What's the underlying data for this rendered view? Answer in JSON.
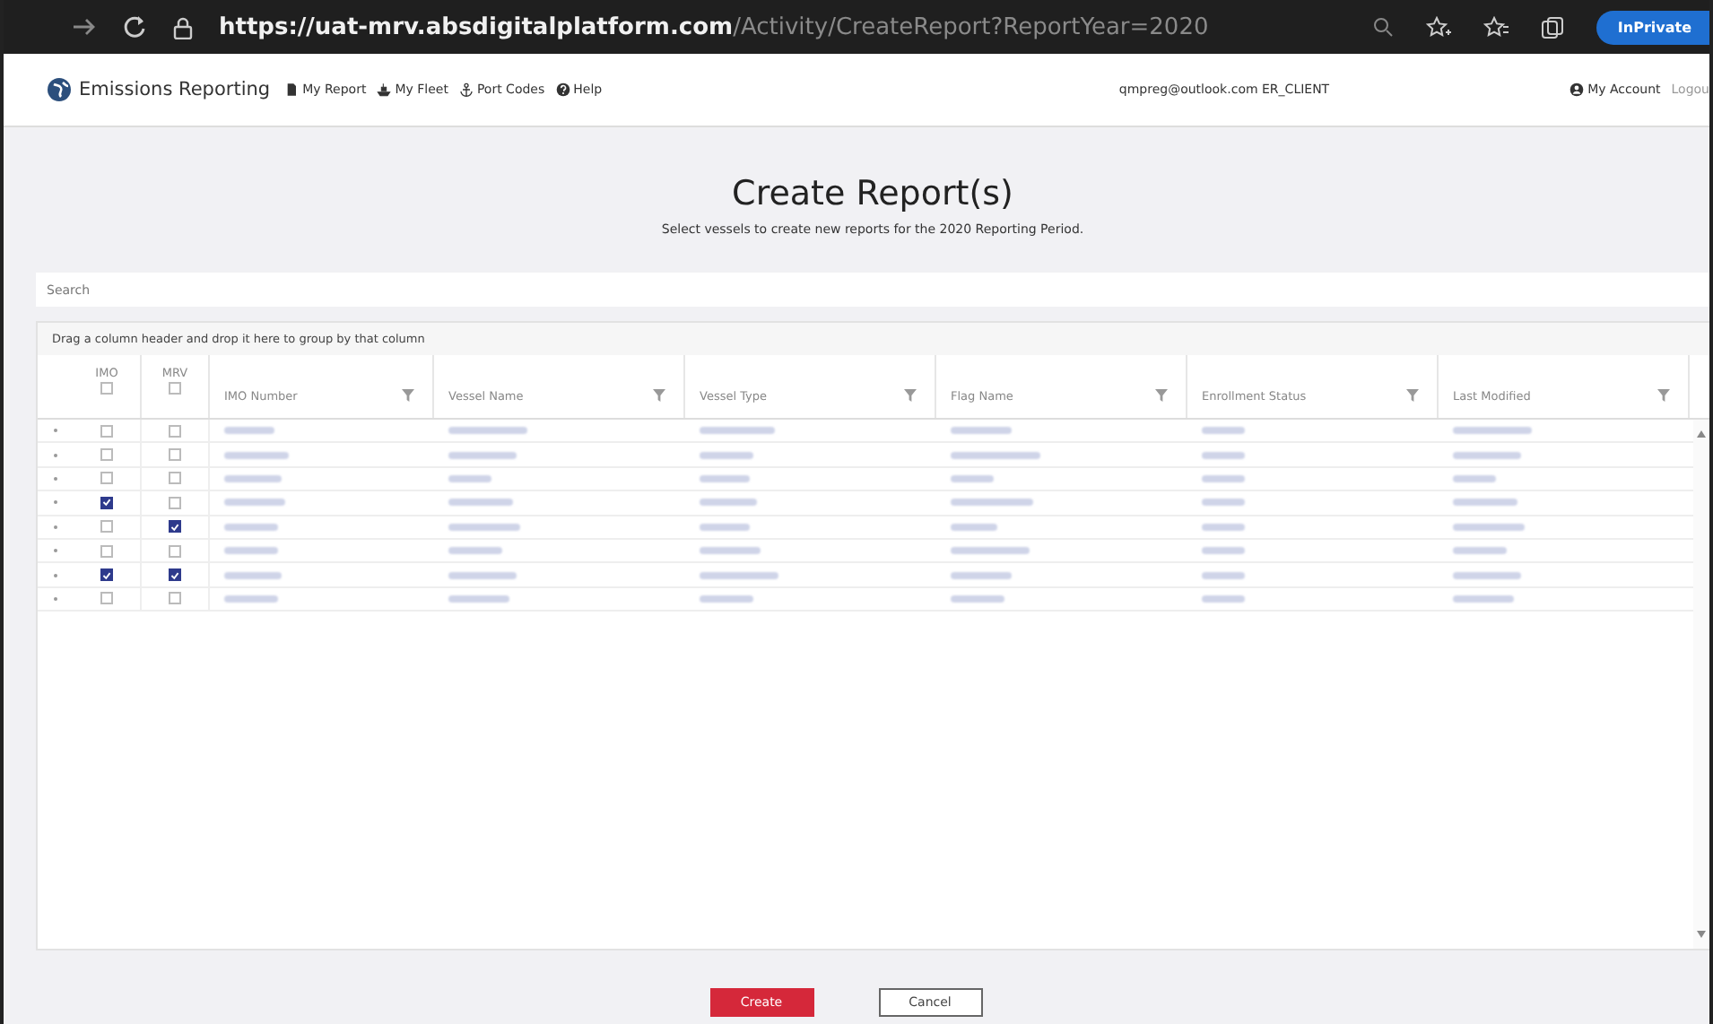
{
  "browser": {
    "url_host": "https://uat-mrv.absdigitalplatform.com",
    "url_path": "/Activity/CreateReport?ReportYear=2020",
    "badge": "InPrivate"
  },
  "nav": {
    "brand": "Emissions Reporting",
    "links": [
      {
        "kind": "report",
        "label": "My Report"
      },
      {
        "kind": "fleet",
        "label": "My Fleet"
      },
      {
        "kind": "anchor",
        "label": "Port Codes"
      },
      {
        "kind": "help",
        "label": "Help"
      }
    ],
    "user": "qmpreg@outlook.com ER_CLIENT",
    "account": "My Account",
    "logout": "Logou"
  },
  "page": {
    "title": "Create Report(s)",
    "subtitle": "Select vessels to create new reports for the 2020 Reporting Period."
  },
  "search": {
    "placeholder": "Search"
  },
  "grid": {
    "group_hint": "Drag a column header and drop it here to group by that column",
    "check_columns": [
      {
        "label": "IMO",
        "checked": false
      },
      {
        "label": "MRV",
        "checked": false
      }
    ],
    "columns": [
      "IMO Number",
      "Vessel Name",
      "Vessel Type",
      "Flag Name",
      "Enrollment Status",
      "Last Modified"
    ],
    "rows": [
      {
        "imo": false,
        "mrv": false
      },
      {
        "imo": false,
        "mrv": false
      },
      {
        "imo": false,
        "mrv": false
      },
      {
        "imo": true,
        "mrv": false
      },
      {
        "imo": false,
        "mrv": true
      },
      {
        "imo": false,
        "mrv": false
      },
      {
        "imo": true,
        "mrv": true
      },
      {
        "imo": false,
        "mrv": false
      }
    ]
  },
  "buttons": [
    {
      "kind": "primary",
      "label": "Create"
    },
    {
      "kind": "secondary",
      "label": "Cancel"
    }
  ]
}
